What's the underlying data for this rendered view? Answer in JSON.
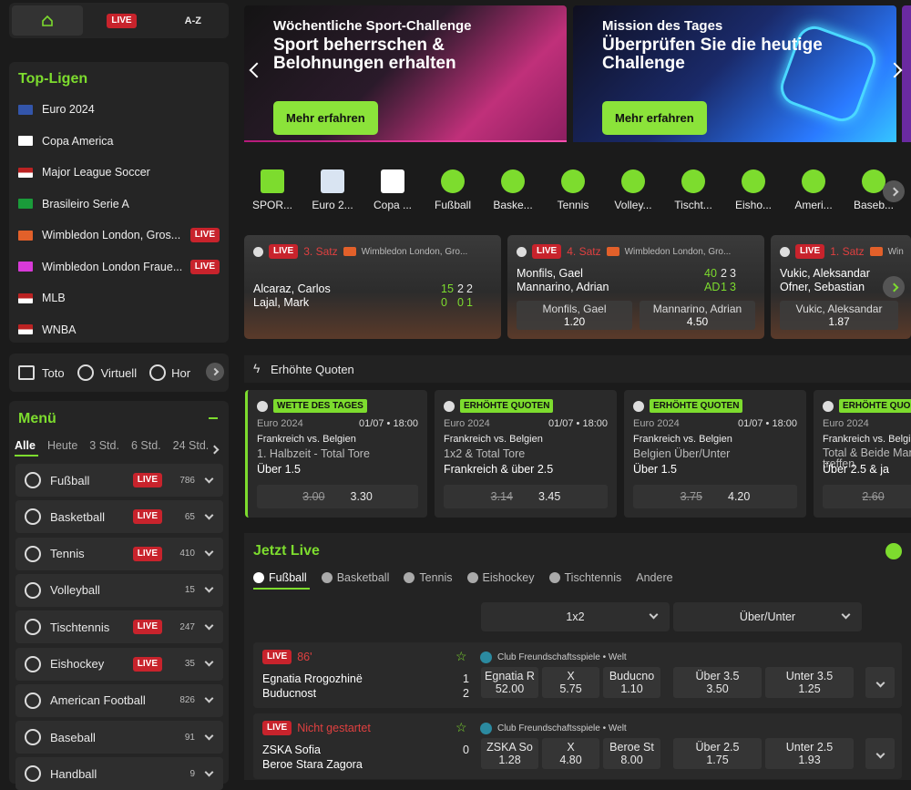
{
  "topnav": {
    "live": "LIVE",
    "az": "A-Z"
  },
  "leagues": {
    "title": "Top-Ligen",
    "items": [
      {
        "label": "Euro 2024",
        "live": false
      },
      {
        "label": "Copa America",
        "live": false
      },
      {
        "label": "Major League Soccer",
        "live": false
      },
      {
        "label": "Brasileiro Serie A",
        "live": false
      },
      {
        "label": "Wimbledon London, Gros...",
        "live": true
      },
      {
        "label": "Wimbledon London Fraue...",
        "live": true
      },
      {
        "label": "MLB",
        "live": false
      },
      {
        "label": "WNBA",
        "live": false
      }
    ],
    "live_label": "LIVE"
  },
  "extras": {
    "toto": "Toto",
    "virtual": "Virtuell",
    "more": "Hor"
  },
  "menu": {
    "title": "Menü",
    "filters": [
      "Alle",
      "Heute",
      "3 Std.",
      "6 Std.",
      "24 Std."
    ],
    "sports": [
      {
        "label": "Fußball",
        "live": true,
        "count": "786"
      },
      {
        "label": "Basketball",
        "live": true,
        "count": "65"
      },
      {
        "label": "Tennis",
        "live": true,
        "count": "410"
      },
      {
        "label": "Volleyball",
        "live": false,
        "count": "15"
      },
      {
        "label": "Tischtennis",
        "live": true,
        "count": "247"
      },
      {
        "label": "Eishockey",
        "live": true,
        "count": "35"
      },
      {
        "label": "American Football",
        "live": false,
        "count": "826"
      },
      {
        "label": "Baseball",
        "live": false,
        "count": "91"
      },
      {
        "label": "Handball",
        "live": false,
        "count": "9"
      }
    ]
  },
  "banners": [
    {
      "kicker": "Wöchentliche Sport-Challenge",
      "headline": "Sport beherrschen & Belohnungen erhalten",
      "button": "Mehr erfahren"
    },
    {
      "kicker": "Mission des Tages",
      "headline": "Überprüfen Sie die heutige Challenge",
      "button": "Mehr erfahren"
    }
  ],
  "sport_strip": [
    "SPOR...",
    "Euro 2...",
    "Copa ...",
    "Fußball",
    "Baske...",
    "Tennis",
    "Volley...",
    "Tischt...",
    "Eisho...",
    "Ameri...",
    "Baseb..."
  ],
  "live_matches": [
    {
      "live": "LIVE",
      "period": "3. Satz",
      "comp": "Wimbledon London, Gro...",
      "p1": "Alcaraz, Carlos",
      "p2": "Lajal, Mark",
      "s1": [
        "15",
        "2",
        "2"
      ],
      "s2": [
        "0",
        "0",
        "1"
      ],
      "o1_name": "",
      "o1": "",
      "o2_name": "",
      "o2": ""
    },
    {
      "live": "LIVE",
      "period": "4. Satz",
      "comp": "Wimbledon London, Gro...",
      "p1": "Monfils, Gael",
      "p2": "Mannarino, Adrian",
      "s1": [
        "40",
        "2",
        "3"
      ],
      "s2": [
        "AD",
        "1",
        "3"
      ],
      "o1_name": "Monfils, Gael",
      "o1": "1.20",
      "o2_name": "Mannarino, Adrian",
      "o2": "4.50"
    },
    {
      "live": "LIVE",
      "period": "1. Satz",
      "comp": "Win",
      "p1": "Vukic, Aleksandar",
      "p2": "Ofner, Sebastian",
      "s1": [],
      "s2": [],
      "o1_name": "Vukic, Aleksandar",
      "o1": "1.87",
      "o2_name": "",
      "o2": ""
    }
  ],
  "boosted": {
    "title": "Erhöhte Quoten",
    "cards": [
      {
        "tag": "WETTE DES TAGES",
        "comp": "Euro 2024",
        "date": "01/07 • 18:00",
        "teams": "Frankreich vs. Belgien",
        "market": "1. Halbzeit - Total Tore",
        "selection": "Über 1.5",
        "old": "3.00",
        "new": "3.30"
      },
      {
        "tag": "ERHÖHTE QUOTEN",
        "comp": "Euro 2024",
        "date": "01/07 • 18:00",
        "teams": "Frankreich vs. Belgien",
        "market": "1x2 & Total Tore",
        "selection": "Frankreich & über 2.5",
        "old": "3.14",
        "new": "3.45"
      },
      {
        "tag": "ERHÖHTE QUOTEN",
        "comp": "Euro 2024",
        "date": "01/07 • 18:00",
        "teams": "Frankreich vs. Belgien",
        "market": "Belgien Über/Unter",
        "selection": "Über 1.5",
        "old": "3.75",
        "new": "4.20"
      },
      {
        "tag": "ERHÖHTE QUO",
        "comp": "Euro 2024",
        "date": "",
        "teams": "Frankreich vs. Belgi",
        "market": "Total & Beide Man treffen",
        "selection": "Über 2.5 & ja",
        "old": "2.60",
        "new": ""
      }
    ]
  },
  "jetzt_live": {
    "title": "Jetzt Live",
    "tabs": [
      "Fußball",
      "Basketball",
      "Tennis",
      "Eishockey",
      "Tischtennis",
      "Andere"
    ],
    "market1": "1x2",
    "market2": "Über/Unter",
    "events": [
      {
        "live": "LIVE",
        "status": "86'",
        "comp": "Club Freundschaftsspiele • Welt",
        "t1": "Egnatia Rrogozhinë",
        "t2": "Buducnost",
        "sc1": "1",
        "sc2": "2",
        "odds": [
          {
            "n": "Egnatia R",
            "v": "52.00"
          },
          {
            "n": "X",
            "v": "5.75"
          },
          {
            "n": "Buducno",
            "v": "1.10"
          }
        ],
        "ou": [
          {
            "n": "Über 3.5",
            "v": "3.50"
          },
          {
            "n": "Unter 3.5",
            "v": "1.25"
          }
        ]
      },
      {
        "live": "LIVE",
        "status": "Nicht gestartet",
        "comp": "Club Freundschaftsspiele • Welt",
        "t1": "ZSKA Sofia",
        "t2": "Beroe Stara Zagora",
        "sc1": "0",
        "sc2": "",
        "odds": [
          {
            "n": "ZSKA So",
            "v": "1.28"
          },
          {
            "n": "X",
            "v": "4.80"
          },
          {
            "n": "Beroe St",
            "v": "8.00"
          }
        ],
        "ou": [
          {
            "n": "Über 2.5",
            "v": "1.75"
          },
          {
            "n": "Unter 2.5",
            "v": "1.93"
          }
        ]
      }
    ]
  },
  "colors": {
    "accent": "#7ddc2e",
    "live": "#c8232c",
    "bg": "#1b1b1b",
    "panel": "#252525"
  }
}
